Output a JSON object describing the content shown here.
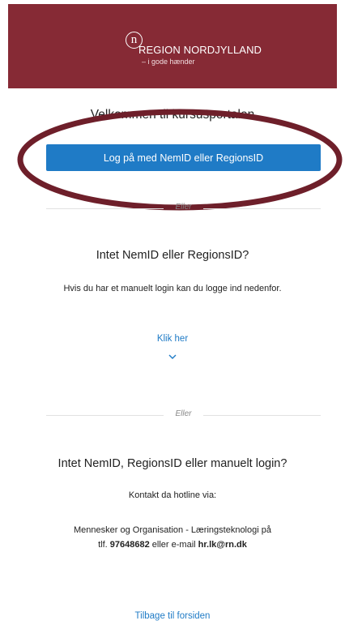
{
  "header": {
    "logo_letter": "n",
    "brand_name": "REGION NORDJYLLAND",
    "tagline": "– i gode hænder",
    "background_color": "#862a35"
  },
  "welcome": {
    "title": "Velkommen til kursusportalen"
  },
  "login": {
    "button_label": "Log på med NemID eller RegionsID",
    "button_color": "#1f7bc6"
  },
  "divider_label": "Eller",
  "manual": {
    "heading": "Intet NemID eller RegionsID?",
    "text": "Hvis du har et manuelt login kan du logge ind nedenfor.",
    "link_label": "Klik her",
    "chevron_icon": "chevron-down-icon"
  },
  "hotline": {
    "heading": "Intet NemID, RegionsID eller manuelt login?",
    "intro": "Kontakt da hotline via:",
    "line1": "Mennesker og Organisation - Læringsteknologi på",
    "phone_prefix": "tlf.",
    "phone": "97648682",
    "mail_prefix": "eller e-mail",
    "email": "hr.lk@rn.dk"
  },
  "footer": {
    "back_link": "Tilbage til forsiden"
  },
  "annotation": {
    "shape": "ellipse",
    "color": "#6e1f2a"
  }
}
